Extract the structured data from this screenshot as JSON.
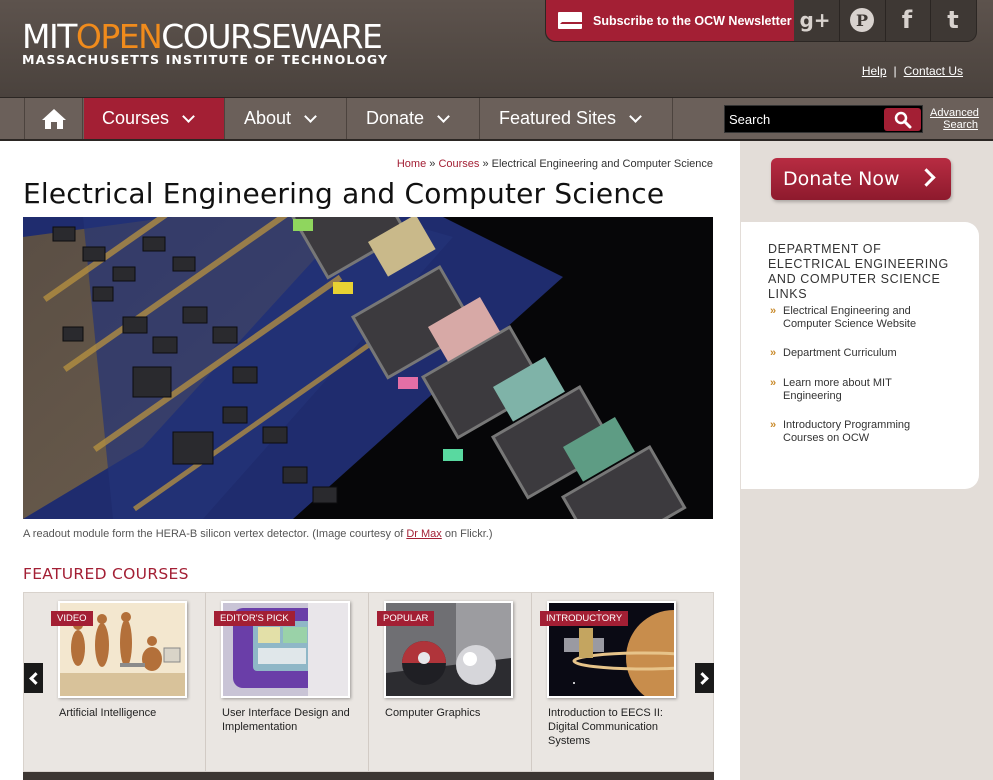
{
  "header": {
    "logo_mit": "MIT",
    "logo_open": "OPEN",
    "logo_courseware": "COURSEWARE",
    "logo_sub": "MASSACHUSETTS INSTITUTE OF TECHNOLOGY",
    "newsletter": "Subscribe to the OCW Newsletter",
    "social": [
      "g+",
      "P",
      "f",
      "t"
    ],
    "help": "Help",
    "separator": "|",
    "contact": "Contact Us"
  },
  "nav": {
    "courses": "Courses",
    "about": "About",
    "donate": "Donate",
    "featured_sites": "Featured Sites",
    "search_placeholder": "Search",
    "advanced_search": "Advanced Search"
  },
  "breadcrumb": {
    "home": "Home",
    "sep": "»",
    "courses": "Courses",
    "current": "Electrical Engineering and Computer Science"
  },
  "page_title": "Electrical Engineering and Computer Science",
  "caption": {
    "before": "A readout module form the HERA-B silicon vertex detector. (Image courtesy of ",
    "link": "Dr Max",
    "after": " on Flickr.)"
  },
  "featured": {
    "heading": "FEATURED COURSES",
    "cards": [
      {
        "tag": "VIDEO",
        "title": "Artificial Intelligence"
      },
      {
        "tag": "EDITOR'S PICK",
        "title": "User Interface Design and Implementation"
      },
      {
        "tag": "POPULAR",
        "title": "Computer Graphics"
      },
      {
        "tag": "INTRODUCTORY",
        "title": "Introduction to EECS II: Digital Communication Systems"
      }
    ]
  },
  "sidebar": {
    "donate_now": "Donate Now",
    "links_title": "DEPARTMENT OF ELECTRICAL ENGINEERING AND COMPUTER SCIENCE LINKS",
    "bullet": "»",
    "links": [
      "Electrical Engineering and Computer Science Website",
      "Department Curriculum",
      "Learn more about MIT Engineering",
      "Introductory Programming Courses on OCW"
    ]
  },
  "colors": {
    "brand_red": "#a31f34",
    "header_brown": "#5d534d",
    "logo_orange": "#f08b1c"
  }
}
